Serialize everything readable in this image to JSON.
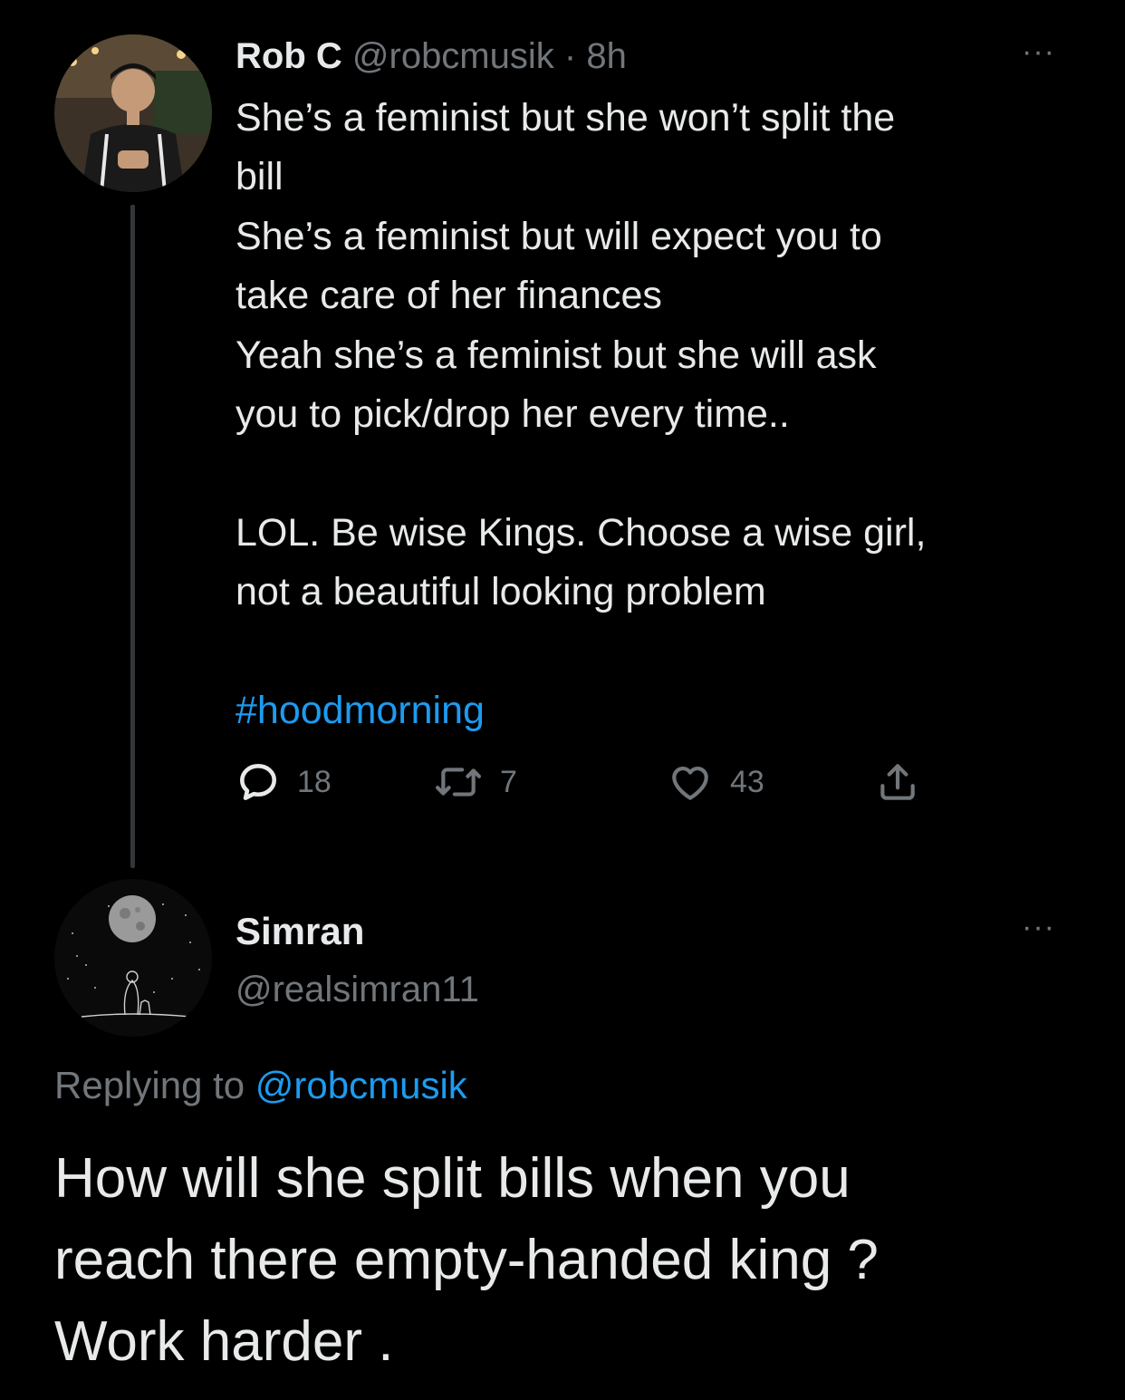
{
  "tweet": {
    "author_name": "Rob C",
    "author_handle": "@robcmusik",
    "separator": "·",
    "time": "8h",
    "more_label": "···",
    "lines": [
      "She’s a feminist but she won’t split the",
      "bill",
      "She’s a feminist but will expect you to",
      "take care of her finances",
      "Yeah she’s a feminist but she will ask",
      "you to pick/drop her every time..",
      "",
      "LOL. Be wise Kings. Choose a wise girl,",
      "not a beautiful looking problem",
      ""
    ],
    "hashtag": "#hoodmorning",
    "reply_count": "18",
    "retweet_count": "7",
    "like_count": "43",
    "icons": [
      "reply-icon",
      "retweet-icon",
      "like-icon",
      "share-icon"
    ]
  },
  "reply": {
    "author_name": "Simran",
    "author_handle": "@realsimran11",
    "more_label": "···",
    "replying_prefix": "Replying to",
    "replying_mention": "@robcmusik",
    "lines": [
      "How will she split bills when you",
      "reach there empty-handed king ?",
      "Work harder ."
    ]
  },
  "colors": {
    "background": "#000000",
    "text": "#e7e9ea",
    "secondary": "#71767b",
    "accent": "#1d9bf0",
    "thread_line": "#333639"
  }
}
